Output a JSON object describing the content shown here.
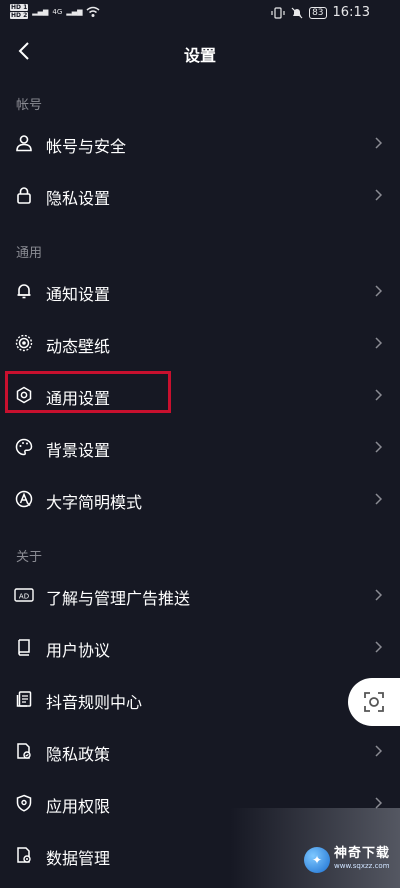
{
  "status_bar": {
    "sim1": "HD 1",
    "sim2": "HD 2",
    "net": "4G",
    "battery": "83",
    "time": "16:13"
  },
  "header": {
    "title": "设置",
    "back_icon": "back-arrow-icon"
  },
  "sections": [
    {
      "label": "帐号",
      "items": [
        {
          "label": "帐号与安全",
          "icon": "user-icon"
        },
        {
          "label": "隐私设置",
          "icon": "lock-icon"
        }
      ]
    },
    {
      "label": "通用",
      "items": [
        {
          "label": "通知设置",
          "icon": "bell-icon"
        },
        {
          "label": "动态壁纸",
          "icon": "dynamic-wallpaper-icon"
        },
        {
          "label": "通用设置",
          "icon": "gear-icon",
          "highlighted": true
        },
        {
          "label": "背景设置",
          "icon": "palette-icon"
        },
        {
          "label": "大字简明模式",
          "icon": "large-text-icon"
        }
      ]
    },
    {
      "label": "关于",
      "items": [
        {
          "label": "了解与管理广告推送",
          "icon": "ad-icon"
        },
        {
          "label": "用户协议",
          "icon": "book-icon"
        },
        {
          "label": "抖音规则中心",
          "icon": "document-icon"
        },
        {
          "label": "隐私政策",
          "icon": "privacy-policy-icon"
        },
        {
          "label": "应用权限",
          "icon": "shield-icon"
        },
        {
          "label": "数据管理",
          "icon": "data-management-icon"
        }
      ]
    }
  ],
  "watermark": {
    "title": "神奇下载",
    "url": "www.sqxzz.com"
  },
  "colors": {
    "background": "#161823",
    "highlight": "#c8102e",
    "muted": "#8a8b93"
  }
}
